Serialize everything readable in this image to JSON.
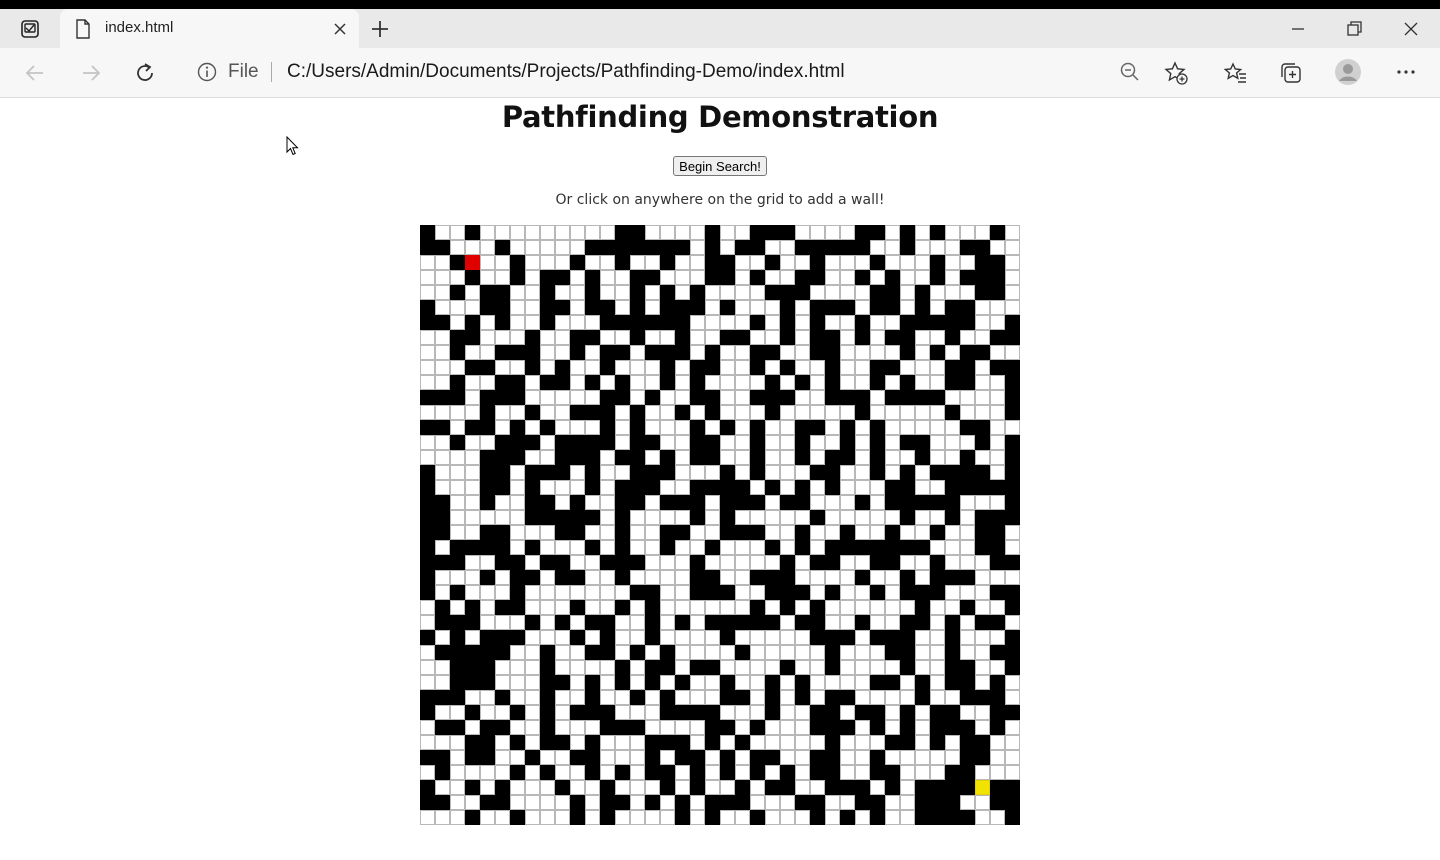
{
  "browser": {
    "tab_title": "index.html",
    "address_scheme": "File",
    "address_url": "C:/Users/Admin/Documents/Projects/Pathfinding-Demo/index.html",
    "icons": [
      "tab-actions-icon",
      "document-icon",
      "close-icon",
      "plus-icon",
      "minimize-icon",
      "restore-icon",
      "close-window-icon",
      "back-arrow-icon",
      "forward-arrow-icon",
      "refresh-icon",
      "info-icon",
      "zoom-out-icon",
      "add-favorite-icon",
      "favorites-icon",
      "collections-icon",
      "profile-icon",
      "more-icon"
    ]
  },
  "page": {
    "title": "Pathfinding Demonstration",
    "button_label": "Begin Search!",
    "hint": "Or click on anywhere on the grid to add a wall!"
  },
  "grid": {
    "cols": 40,
    "rows": 40,
    "colors": {
      "wall": "#000000",
      "start": "#e00000",
      "goal": "#f2e200",
      "empty": "#ffffff"
    },
    "start": [
      3,
      2
    ],
    "goal": [
      37,
      37
    ],
    "walls": [
      "#..#.........##....#..###....##.#.#...#.",
      "##...#.....#######.#.##..#####..#...##..",
      "..##..#...#..#..#..##..#..#...#...#..##.",
      "...#..#.##.#..##...##.#..##..#.#..#.###.",
      "..#.##..#..#..#.#.#....###....##.#...##.",
      "#...##..##.##.#.###.#...#.###.##.#.##...",
      "##.#.#..#...######....#.#.#..#..#####..#",
      "..##...#..##..#..#..##..#.##.#.##..#..##",
      "..#..###..#.##.###.#..##..##....#.#.##..",
      "...##..#.#..#...#.##..#.#..#..##...##.##",
      "..#..##.##.#.#..#.#....#.#.#..#.#..##..#",
      "###.###.....##.#..##..###..###.####....#",
      "....#..#..###.#..#.#...#.....#.....#...#",
      "##.##.#.#...#.#...#.#.#..##.#.#.....##..",
      "..#..###.####.##..##..#..#..#.#.##...#.#",
      "....###..###.##.#.##..#..#.##.#..#..#..#",
      "#...##.###.#..###...#.#...##..#.#.####.#",
      "#...##.#...#.###..####.#.#.#...##..#####",
      "##..#..##.#..##.###.###.##...#.#####...#",
      "##.....#####.#....#.#.....#.....#..#.###",
      "##..##...##..#..##..###..#..#..#..#..##.",
      "#.####.#...#.#..#..#...#.#.#######...##.",
      "###..##.##..###...#.....#.##..##..#...##",
      "#...#.##.##..#....##..###....#..#.###...",
      "#.#...#.......##..###..###.#..#.###...##",
      ".#.#.##...#..#.#......#.#.#......#..#..#",
      ".###...#.#.##..#.#.#####.##..#..##.#.##.",
      "#.#.###...#.#..#....#.....###.###..#...#",
      ".#####..#..##.#.#....#.....#...##..#..##",
      "..###...#....#.##.##....#..#....#..##..#",
      "..###...##.#.#.#.#..#..#.#....##.#.##.#.",
      "###..#..#..#..#.#...##.#.#.##....#..###.",
      "#..#..#.#.###...####...#..##.##.#.##..##",
      ".##.##..#...###....##.#...###.#.#.###.#.",
      "...##.#.##.#...###.#.#.....#...##.#.##..",
      "##.##..#..##...#.##.#.##..##..#.....##..",
      ".#....#.#..#.#.##.#.#.#.#.##..##...##...",
      "#..#.#...#..#...#.#..#.##..###.#.####.##",
      "##..##....#.##.#.#.###...##..##..###..##",
      "...#..#...#.#....#.#..#...#.#.#..####..#"
    ]
  }
}
